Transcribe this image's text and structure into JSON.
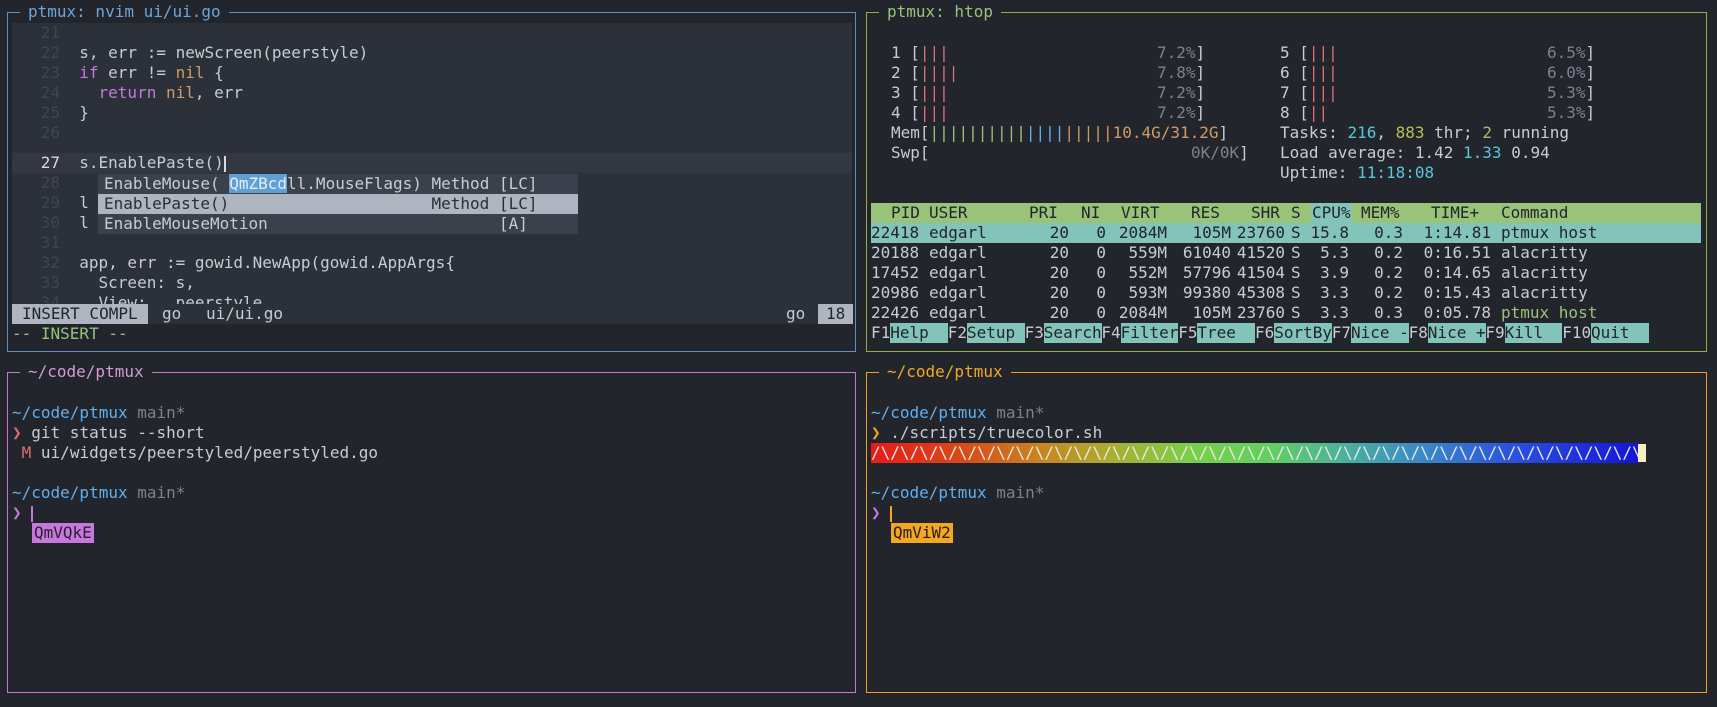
{
  "colors": {
    "blue": "#61afef",
    "green": "#98c379",
    "purple": "#c678dd",
    "orange": "#f5a623"
  },
  "panes": {
    "nvim_title": "ptmux: nvim ui/ui.go",
    "htop_title": "ptmux: htop",
    "shell1_title": "~/code/ptmux",
    "shell2_title": "~/code/ptmux"
  },
  "nvim": {
    "line_numbers": [
      "21",
      "22",
      "23",
      "24",
      "25",
      "26",
      "27",
      "28",
      "29",
      "30",
      "31",
      "32",
      "33",
      "34"
    ],
    "current_line": "27",
    "code": {
      "l22": "s, err := newScreen(peerstyle)",
      "l23_kw": "if",
      "l23_a": " err != ",
      "l23_nil": "nil",
      "l23_b": " {",
      "l24_kw": "return",
      "l24_sp": " ",
      "l24_nil": "nil",
      "l24_b": ", err",
      "l25": "}",
      "l27": "s.EnablePaste()",
      "l29": "l",
      "l30": "l",
      "l32": "app, err := gowid.NewApp(gowid.AppArgs{",
      "l33": "  Screen: s,",
      "l34": "  View:   peerstyle,"
    },
    "completion": [
      {
        "pre": "EnableMouse( ",
        "hint": "QmZBcd",
        "post": "ll.MouseFlags) Method [LC]"
      },
      {
        "text": "EnablePaste()                     Method [LC]"
      },
      {
        "text": "EnableMouseMotion                        [A]"
      }
    ],
    "status": {
      "mode": "INSERT COMPL",
      "ft": "go",
      "file": "ui/ui.go",
      "ft_right": "go",
      "col": "18"
    },
    "mode_line": "-- INSERT --"
  },
  "htop": {
    "cpus": [
      {
        "num": "1",
        "bars": "|||",
        "pct": "7.2%"
      },
      {
        "num": "2",
        "bars": "||||",
        "pct": "7.8%"
      },
      {
        "num": "3",
        "bars": "|||",
        "pct": "7.2%"
      },
      {
        "num": "4",
        "bars": "|||",
        "pct": "7.2%"
      },
      {
        "num": "5",
        "bars": "|||",
        "pct": "6.5%"
      },
      {
        "num": "6",
        "bars": "|||",
        "pct": "6.0%"
      },
      {
        "num": "7",
        "bars": "|||",
        "pct": "5.3%"
      },
      {
        "num": "8",
        "bars": "||",
        "pct": "5.3%"
      }
    ],
    "mem_label": "Mem",
    "mem_value": "10.4G/31.2G",
    "swp_label": "Swp",
    "swp_value": "0K/0K",
    "tasks_label": "Tasks: ",
    "tasks": "216",
    "thr": "883",
    "thr_label": " thr; ",
    "running": "2",
    "running_label": " running",
    "load_label": "Load average: ",
    "load1": "1.42",
    "load5": "1.33",
    "load15": "0.94",
    "uptime_label": "Uptime: ",
    "uptime": "11:18:08",
    "columns": [
      "PID",
      "USER",
      "PRI",
      "NI",
      "VIRT",
      "RES",
      "SHR",
      "S",
      "CPU%",
      "MEM%",
      "TIME+",
      "Command"
    ],
    "processes": [
      [
        "22418",
        "edgarl",
        "20",
        "0",
        "2084M",
        "105M",
        "23760",
        "S",
        "15.8",
        "0.3",
        "1:14.81",
        "ptmux host"
      ],
      [
        "20188",
        "edgarl",
        "20",
        "0",
        "559M",
        "61040",
        "41520",
        "S",
        "5.3",
        "0.2",
        "0:16.51",
        "alacritty"
      ],
      [
        "17452",
        "edgarl",
        "20",
        "0",
        "552M",
        "57796",
        "41504",
        "S",
        "3.9",
        "0.2",
        "0:14.65",
        "alacritty"
      ],
      [
        "20986",
        "edgarl",
        "20",
        "0",
        "593M",
        "99380",
        "45308",
        "S",
        "3.3",
        "0.2",
        "0:15.43",
        "alacritty"
      ],
      [
        "22426",
        "edgarl",
        "20",
        "0",
        "2084M",
        "105M",
        "23760",
        "S",
        "3.3",
        "0.3",
        "0:05.78",
        "ptmux host"
      ]
    ],
    "fkeys": [
      {
        "key": "F1",
        "label": "Help  "
      },
      {
        "key": "F2",
        "label": "Setup "
      },
      {
        "key": "F3",
        "label": "Search"
      },
      {
        "key": "F4",
        "label": "Filter"
      },
      {
        "key": "F5",
        "label": "Tree  "
      },
      {
        "key": "F6",
        "label": "SortBy"
      },
      {
        "key": "F7",
        "label": "Nice -"
      },
      {
        "key": "F8",
        "label": "Nice +"
      },
      {
        "key": "F9",
        "label": "Kill  "
      },
      {
        "key": "F10",
        "label": "Quit  "
      }
    ]
  },
  "shell1": {
    "path": "~/code/ptmux",
    "branch": " main*",
    "prompt": "❯",
    "cmd": " git status --short",
    "status_flag": "M",
    "status_file": " ui/widgets/peerstyled/peerstyled.go",
    "path2": "~/code/ptmux",
    "branch2": " main*",
    "prompt2": "❯",
    "hint": "QmVQkE"
  },
  "shell2": {
    "path": "~/code/ptmux",
    "branch": " main*",
    "prompt": "❯",
    "cmd": " ./scripts/truecolor.sh",
    "rainbow": "/\\/\\/\\/\\/\\/\\/\\/\\/\\/\\/\\/\\/\\/\\/\\/\\/\\/\\/\\/\\/\\/\\/\\/\\/\\/\\/\\/\\/\\/\\/\\/\\/\\/\\/\\/\\/\\/\\/\\/\\/\\/\\/\\/\\/\\/\\/\\/\\/\\/\\/\\/\\/\\/\\",
    "path2": "~/code/ptmux",
    "branch2": " main*",
    "prompt2": "❯",
    "hint": "QmViW2"
  }
}
